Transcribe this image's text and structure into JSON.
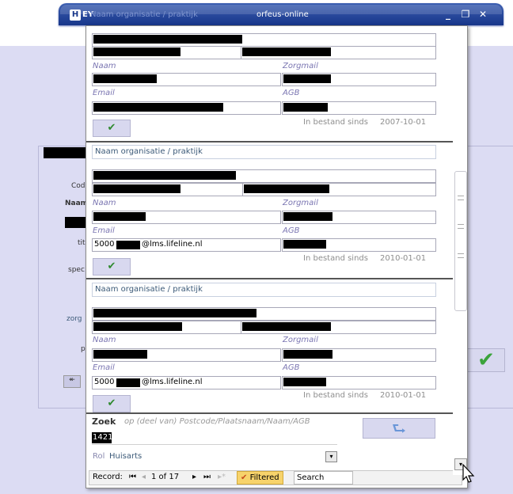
{
  "window": {
    "title": "orfeus-online",
    "faint_title": "Naam organisatie / praktijk",
    "icon1": "H",
    "icon2": "EY",
    "min_label": "_",
    "restore_label": "❐",
    "close_label": "✕"
  },
  "background": {
    "code_label": "Cod",
    "naam_label": "Naam",
    "tit_label": "tit",
    "spec_label": "spec",
    "zorg_label": "zorg",
    "p_label": "p",
    "back_btn": "↞"
  },
  "records": [
    {
      "org_label": "",
      "naam_label": "Naam",
      "zorgmail_label": "Zorgmail",
      "email_label": "Email",
      "agb_label": "AGB",
      "email_value": "",
      "since_label": "In bestand sinds",
      "since_value": "2007-10-01"
    },
    {
      "org_label": "Naam organisatie / praktijk",
      "naam_label": "Naam",
      "zorgmail_label": "Zorgmail",
      "email_label": "Email",
      "agb_label": "AGB",
      "email_prefix": "5000",
      "email_suffix": "@lms.lifeline.nl",
      "since_label": "In bestand sinds",
      "since_value": "2010-01-01"
    },
    {
      "org_label": "Naam organisatie / praktijk",
      "naam_label": "Naam",
      "zorgmail_label": "Zorgmail",
      "email_label": "Email",
      "agb_label": "AGB",
      "email_prefix": "5000",
      "email_suffix": "@lms.lifeline.nl",
      "since_label": "In bestand sinds",
      "since_value": "2010-01-01"
    }
  ],
  "search": {
    "zoek_label": "Zoek",
    "hint": "op (deel van) Postcode/Plaatsnaam/Naam/AGB",
    "value": "1421",
    "rol_label": "Rol",
    "rol_value": "Huisarts"
  },
  "navigation": {
    "record_label": "Record:",
    "position": "1 of 17",
    "filtered_label": "Filtered",
    "search_label": "Search"
  },
  "colors": {
    "title_bar": "#17368a",
    "background": "#dcdcf3",
    "label": "#7b76b2",
    "ok_check": "#2f8a2f"
  }
}
